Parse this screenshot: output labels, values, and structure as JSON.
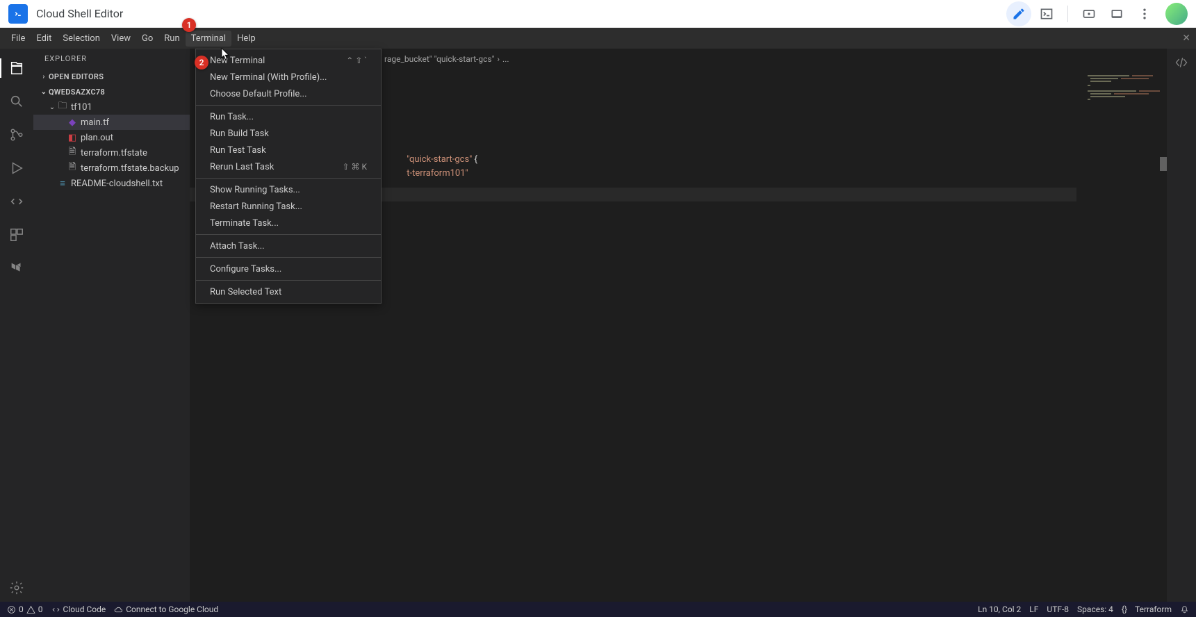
{
  "chrome": {
    "title": "Cloud Shell Editor"
  },
  "menu": {
    "items": [
      "File",
      "Edit",
      "Selection",
      "View",
      "Go",
      "Run",
      "Terminal",
      "Help"
    ],
    "active_index": 6
  },
  "explorer": {
    "title": "EXPLORER",
    "sections": {
      "open_editors": "OPEN EDITORS",
      "workspace": "QWEDSAZXC78"
    },
    "tree": [
      {
        "label": "tf101",
        "type": "folder",
        "expanded": true,
        "indent": 2
      },
      {
        "label": "main.tf",
        "type": "tf",
        "indent": 3,
        "selected": true
      },
      {
        "label": "plan.out",
        "type": "plan",
        "indent": 3
      },
      {
        "label": "terraform.tfstate",
        "type": "file",
        "indent": 3
      },
      {
        "label": "terraform.tfstate.backup",
        "type": "file",
        "indent": 3
      },
      {
        "label": "README-cloudshell.txt",
        "type": "txt",
        "indent": 2
      }
    ]
  },
  "dropdown": {
    "groups": [
      [
        {
          "label": "New Terminal",
          "shortcut": "⌃ ⇧ `"
        },
        {
          "label": "New Terminal (With Profile)..."
        },
        {
          "label": "Choose Default Profile..."
        }
      ],
      [
        {
          "label": "Run Task..."
        },
        {
          "label": "Run Build Task"
        },
        {
          "label": "Run Test Task"
        },
        {
          "label": "Rerun Last Task",
          "shortcut": "⇧ ⌘ K"
        }
      ],
      [
        {
          "label": "Show Running Tasks..."
        },
        {
          "label": "Restart Running Task..."
        },
        {
          "label": "Terminate Task..."
        }
      ],
      [
        {
          "label": "Attach Task..."
        }
      ],
      [
        {
          "label": "Configure Tasks..."
        }
      ],
      [
        {
          "label": "Run Selected Text"
        }
      ]
    ]
  },
  "breadcrumb": {
    "parts": [
      "rage_bucket\" \"quick-start-gcs\"",
      "›",
      "..."
    ]
  },
  "code": {
    "line1_pre": "\"quick-start-gcs\"",
    "line1_brace": " {",
    "line2": "t-terraform101\""
  },
  "status": {
    "errors": "0",
    "warnings": "0",
    "cloud_code": "Cloud Code",
    "connect": "Connect to Google Cloud",
    "position": "Ln 10, Col 2",
    "eol": "LF",
    "encoding": "UTF-8",
    "spaces": "Spaces: 4",
    "lang_icon": "{}",
    "language": "Terraform"
  },
  "callouts": {
    "one": "1",
    "two": "2"
  }
}
